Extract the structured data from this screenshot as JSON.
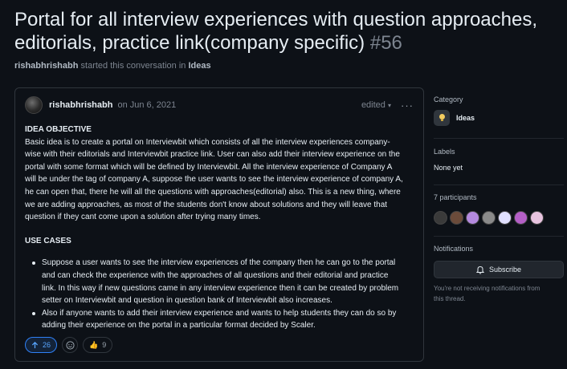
{
  "header": {
    "title": "Portal for all interview experiences with question approaches, editorials, practice link(company specific)",
    "number": "#56"
  },
  "byline": {
    "user": "rishabhrishabh",
    "text": "started this conversation in",
    "category": "Ideas"
  },
  "post": {
    "author": "rishabhrishabh",
    "date": "on Jun 6, 2021",
    "edited_label": "edited",
    "more_icon": "kebab-horizontal-icon",
    "idea_heading": "IDEA OBJECTIVE",
    "idea_lines": [
      "Basic idea is to create a portal on Interviewbit which consists of all the interview experiences company-",
      "wise with their editorials and Interviewbit practice link. User can also add their interview experience on the",
      "portal with some format which will be defined by Interviewbit. All the interview experience of Company A",
      "will be under the tag of company A, suppose the user wants to see the interview experience of company A,",
      "he can open that, there he will all the questions with approaches(editorial) also. This is a new thing, where",
      "we are adding approaches, as most of the students don't know about solutions and they will leave that",
      "question if they cant come upon a solution after trying many times."
    ],
    "use_heading": "USE CASES",
    "use_cases": [
      [
        "Suppose a user wants to see the interview experiences of the company then he can go to the portal",
        "and can check the experience with the approaches of all questions and their editorial and practice",
        "link. In this way if new questions came in any interview experience then it can be created by problem",
        "setter on Interviewbit and question in question bank of Interviewbit also increases."
      ],
      [
        "Also if anyone wants to add their interview experience and wants to help students they can do so by",
        "adding their experience on the portal in a particular format decided by Scaler."
      ]
    ],
    "upvotes": "26",
    "thumbs": "9"
  },
  "sidebar": {
    "category_label": "Category",
    "category_icon": "light-bulb-icon",
    "category_name": "Ideas",
    "labels_label": "Labels",
    "labels_value": "None yet",
    "participants_label": "7 participants",
    "participant_colors": [
      "#3a3a3a",
      "#6b4b3a",
      "#b48adf",
      "#8a8a8a",
      "#e0e0ff",
      "#b45fc7",
      "#e8c4e0"
    ],
    "notifications_label": "Notifications",
    "subscribe_label": "Subscribe",
    "notif_hint_1": "You're not receiving notifications from",
    "notif_hint_2": "this thread."
  }
}
